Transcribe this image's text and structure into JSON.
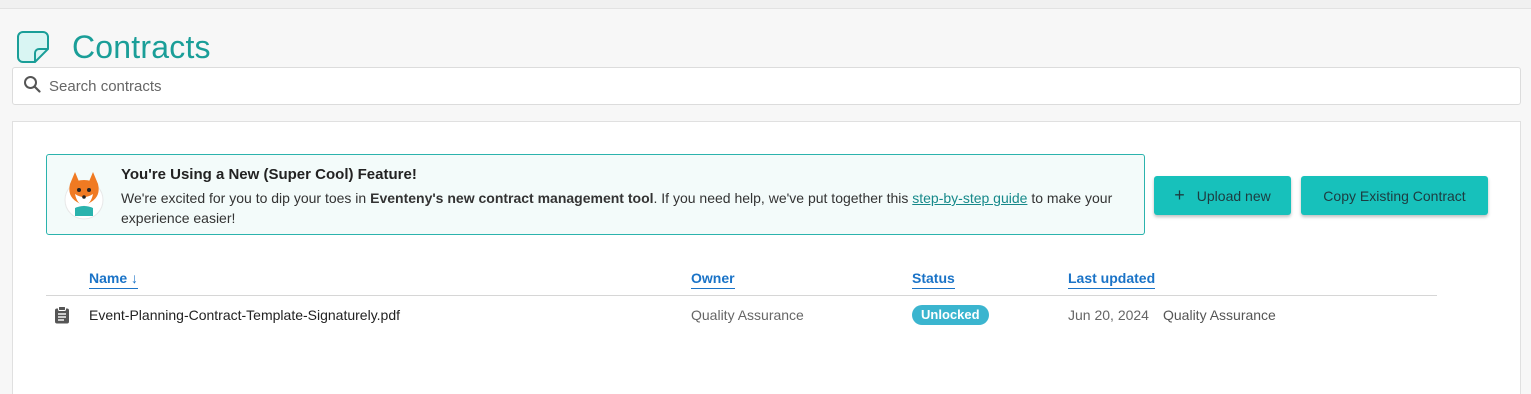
{
  "header": {
    "title": "Contracts",
    "icon": "sticky-note-icon"
  },
  "search": {
    "placeholder": "Search contracts",
    "value": ""
  },
  "banner": {
    "title": "You're Using a New (Super Cool) Feature!",
    "text_part1": "We're excited for you to dip your toes in ",
    "text_bold": "Eventeny's new contract management tool",
    "text_part2": ". If you need help, we've put together this ",
    "link_text": "step-by-step guide",
    "text_part3": " to make your experience easier!",
    "mascot": "fox-mascot-icon"
  },
  "actions": {
    "upload_label": "Upload new",
    "copy_label": "Copy Existing Contract"
  },
  "table": {
    "columns": {
      "name": "Name ↓",
      "owner": "Owner",
      "status": "Status",
      "last_updated": "Last updated"
    },
    "rows": [
      {
        "name": "Event-Planning-Contract-Template-Signaturely.pdf",
        "owner": "Quality Assurance",
        "status": "Unlocked",
        "updated_date": "Jun 20, 2024",
        "updated_by": "Quality Assurance",
        "icon": "clipboard-icon"
      }
    ]
  },
  "colors": {
    "accent": "#1a9e98",
    "button": "#17c1bb",
    "link": "#1a73c7",
    "badge": "#3bb5cf"
  }
}
